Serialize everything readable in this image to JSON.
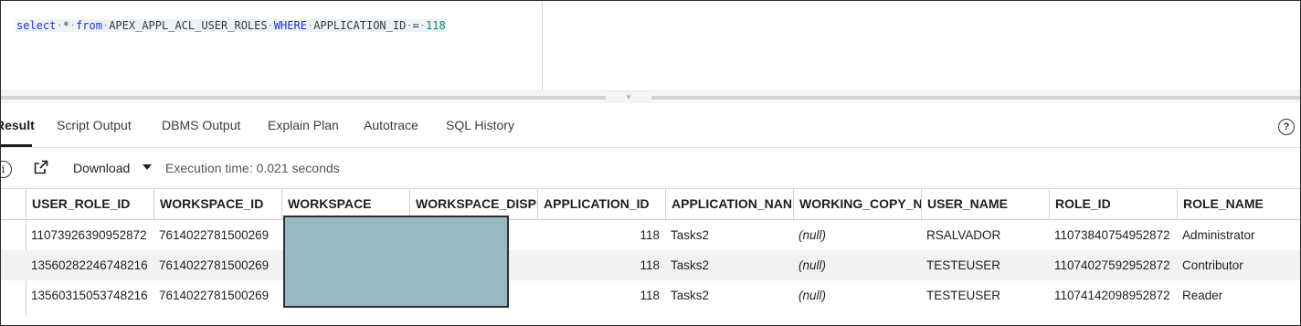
{
  "editor": {
    "sql": {
      "select": "select",
      "star": "*",
      "from": "from",
      "table": "APEX_APPL_ACL_USER_ROLES",
      "where": "WHERE",
      "column": "APPLICATION_ID",
      "op": "=",
      "value": "118"
    }
  },
  "tabs": [
    {
      "label": "Result",
      "active": true
    },
    {
      "label": "Script Output"
    },
    {
      "label": "DBMS Output"
    },
    {
      "label": "Explain Plan"
    },
    {
      "label": "Autotrace"
    },
    {
      "label": "SQL History"
    }
  ],
  "toolbar": {
    "download_label": "Download",
    "execution_time": "Execution time: 0.021 seconds",
    "help_icon": "help-icon",
    "info_icon": "info-icon",
    "open_icon": "open-external-icon"
  },
  "table": {
    "columns": [
      "USER_ROLE_ID",
      "WORKSPACE_ID",
      "WORKSPACE",
      "WORKSPACE_DISPI",
      "APPLICATION_ID",
      "APPLICATION_NAN",
      "WORKING_COPY_N",
      "USER_NAME",
      "ROLE_ID",
      "ROLE_NAME"
    ],
    "rows": [
      [
        "11073926390952872",
        "7614022781500269",
        "",
        "",
        "118",
        "Tasks2",
        "(null)",
        "RSALVADOR",
        "11073840754952872",
        "Administrator"
      ],
      [
        "13560282246748216",
        "7614022781500269",
        "",
        "",
        "118",
        "Tasks2",
        "(null)",
        "TESTEUSER",
        "11074027592952872",
        "Contributor"
      ],
      [
        "13560315053748216",
        "7614022781500269",
        "",
        "",
        "118",
        "Tasks2",
        "(null)",
        "TESTEUSER",
        "11074142098952872",
        "Reader"
      ]
    ]
  },
  "colors": {
    "accent_text": "#1c1c1c",
    "keyword": "#1a35d6",
    "number": "#0b8a6d",
    "redaction": "#98b9c2"
  }
}
